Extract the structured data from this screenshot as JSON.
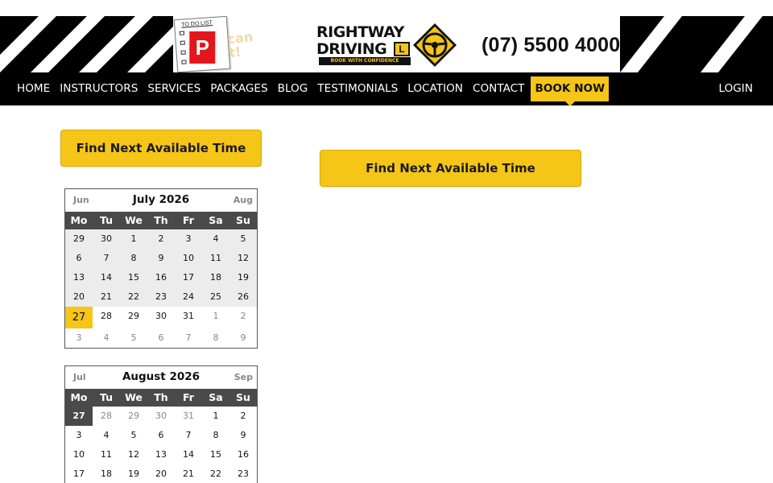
{
  "header": {
    "todo_title": "TO DO LIST",
    "p_plate": "P",
    "sticker_line1": "can",
    "sticker_line2": "t!",
    "logo_line1": "RIGHTWAY",
    "logo_line2": "DRIVING",
    "logo_plate": "L",
    "logo_tagline": "BOOK WITH CONFIDENCE",
    "phone": "(07) 5500 4000",
    "brand_color": "#f5c518"
  },
  "nav": {
    "items": [
      "HOME",
      "INSTRUCTORS",
      "SERVICES",
      "PACKAGES",
      "BLOG",
      "TESTIMONIALS",
      "LOCATION",
      "CONTACT"
    ],
    "book_now": "BOOK NOW",
    "login": "LOGIN"
  },
  "buttons": {
    "find_next_1": "Find Next Available Time",
    "find_next_2": "Find Next Available Time"
  },
  "calendars": [
    {
      "prev": "Jun",
      "title": "July 2026",
      "next": "Aug",
      "dow": [
        "Mo",
        "Tu",
        "We",
        "Th",
        "Fr",
        "Sa",
        "Su"
      ],
      "weeks": [
        [
          "29",
          "30",
          "1",
          "2",
          "3",
          "4",
          "5"
        ],
        [
          "6",
          "7",
          "8",
          "9",
          "10",
          "11",
          "12"
        ],
        [
          "13",
          "14",
          "15",
          "16",
          "17",
          "18",
          "19"
        ],
        [
          "20",
          "21",
          "22",
          "23",
          "24",
          "25",
          "26"
        ],
        [
          "27",
          "28",
          "29",
          "30",
          "31",
          "1",
          "2"
        ],
        [
          "3",
          "4",
          "5",
          "6",
          "7",
          "8",
          "9"
        ]
      ]
    },
    {
      "prev": "Jul",
      "title": "August 2026",
      "next": "Sep",
      "dow": [
        "Mo",
        "Tu",
        "We",
        "Th",
        "Fr",
        "Sa",
        "Su"
      ],
      "weeks": [
        [
          "27",
          "28",
          "29",
          "30",
          "31",
          "1",
          "2"
        ],
        [
          "3",
          "4",
          "5",
          "6",
          "7",
          "8",
          "9"
        ],
        [
          "10",
          "11",
          "12",
          "13",
          "14",
          "15",
          "16"
        ],
        [
          "17",
          "18",
          "19",
          "20",
          "21",
          "22",
          "23"
        ]
      ]
    }
  ]
}
